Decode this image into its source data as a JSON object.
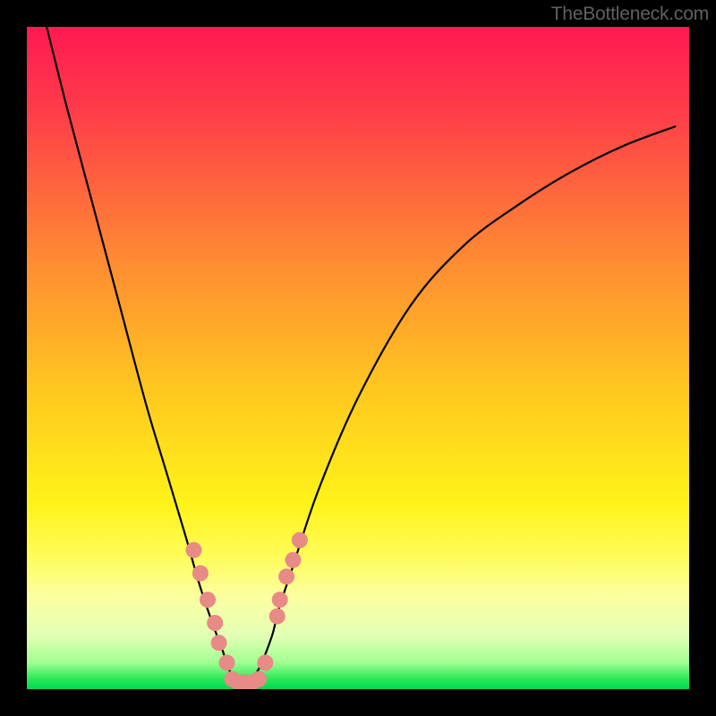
{
  "watermark": "TheBottleneck.com",
  "chart_data": {
    "type": "line",
    "title": "",
    "xlabel": "",
    "ylabel": "",
    "xlim": [
      0,
      100
    ],
    "ylim": [
      0,
      100
    ],
    "background_gradient": {
      "stops": [
        {
          "offset": 0.0,
          "color": "#ff1a52"
        },
        {
          "offset": 0.12,
          "color": "#ff3a4a"
        },
        {
          "offset": 0.35,
          "color": "#ff8a33"
        },
        {
          "offset": 0.55,
          "color": "#ffc81f"
        },
        {
          "offset": 0.72,
          "color": "#fff319"
        },
        {
          "offset": 0.8,
          "color": "#fffc5a"
        },
        {
          "offset": 0.86,
          "color": "#fcffa0"
        },
        {
          "offset": 0.92,
          "color": "#e2ffb5"
        },
        {
          "offset": 0.96,
          "color": "#a0ff90"
        },
        {
          "offset": 0.985,
          "color": "#28e858"
        },
        {
          "offset": 1.0,
          "color": "#00d850"
        }
      ]
    },
    "series": [
      {
        "name": "bottleneck-curve",
        "x": [
          3,
          6,
          10,
          14,
          18,
          21,
          24,
          26,
          28,
          29.5,
          30.5,
          31.5,
          32.5,
          33.5,
          35,
          37,
          38,
          40,
          44,
          50,
          58,
          66,
          74,
          82,
          90,
          98
        ],
        "y": [
          100,
          88,
          73,
          58,
          43,
          33,
          23,
          16,
          10,
          6,
          3,
          1.5,
          1,
          1.5,
          3,
          8,
          12,
          18,
          30,
          44,
          58,
          67,
          73,
          78,
          82,
          85
        ]
      }
    ],
    "scatter_points": {
      "name": "highlighted-configs",
      "color": "#e88a86",
      "radius": 9,
      "points": [
        {
          "x": 25.2,
          "y": 21.0
        },
        {
          "x": 26.2,
          "y": 17.5
        },
        {
          "x": 27.3,
          "y": 13.5
        },
        {
          "x": 28.4,
          "y": 10.0
        },
        {
          "x": 29.0,
          "y": 7.0
        },
        {
          "x": 30.2,
          "y": 4.0
        },
        {
          "x": 31.0,
          "y": 1.5
        },
        {
          "x": 32.0,
          "y": 1.0
        },
        {
          "x": 33.0,
          "y": 1.0
        },
        {
          "x": 34.0,
          "y": 1.0
        },
        {
          "x": 35.0,
          "y": 1.5
        },
        {
          "x": 36.0,
          "y": 4.0
        },
        {
          "x": 37.8,
          "y": 11.0
        },
        {
          "x": 38.2,
          "y": 13.5
        },
        {
          "x": 39.2,
          "y": 17.0
        },
        {
          "x": 40.2,
          "y": 19.5
        },
        {
          "x": 41.2,
          "y": 22.5
        }
      ]
    }
  }
}
